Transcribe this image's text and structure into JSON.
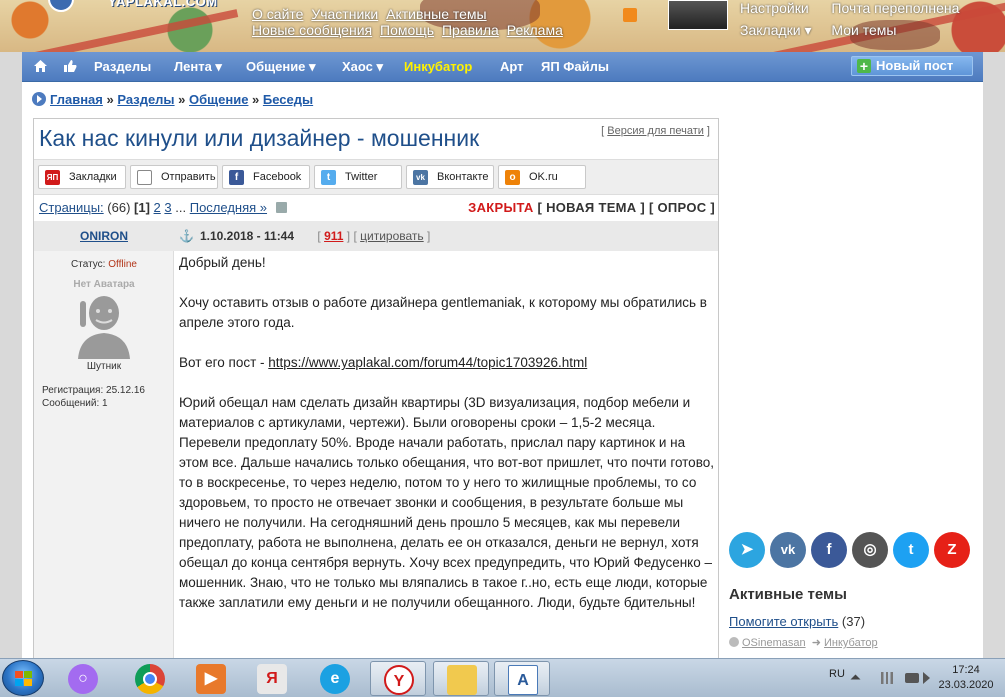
{
  "header": {
    "logo": "YAPLAKAL.COM",
    "links_row1": [
      "О сайте",
      "Участники",
      "Активные темы"
    ],
    "links_row2": [
      "Новые сообщения",
      "Помощь",
      "Правила",
      "Реклама"
    ],
    "user_menu": {
      "col1": [
        "Настройки",
        "Закладки ▾"
      ],
      "col2": [
        "Почта переполнена",
        "Мои темы"
      ]
    }
  },
  "nav": {
    "items": [
      "Разделы",
      "Лента ▾",
      "Общение ▾",
      "Хаос ▾",
      "Инкубатор",
      "Арт",
      "ЯП Файлы"
    ],
    "new_post": "Новый пост"
  },
  "breadcrumb": [
    "Главная",
    "Разделы",
    "Общение",
    "Беседы"
  ],
  "topic": {
    "title": "Как нас кинули или дизайнер - мошенник",
    "print_version": "Версия для печати"
  },
  "share": [
    {
      "label": "Закладки",
      "icon": "yap-bookmark-icon",
      "color": "#d11a1a"
    },
    {
      "label": "Отправить",
      "icon": "mail-icon",
      "color": "#888888"
    },
    {
      "label": "Facebook",
      "icon": "facebook-icon",
      "color": "#3b5998"
    },
    {
      "label": "Twitter",
      "icon": "twitter-icon",
      "color": "#55acee"
    },
    {
      "label": "Вконтакте",
      "icon": "vk-icon",
      "color": "#4c75a3"
    },
    {
      "label": "OK.ru",
      "icon": "ok-icon",
      "color": "#ee8208"
    }
  ],
  "pages": {
    "label": "Страницы:",
    "count": "(66)",
    "current": "[1]",
    "p2": "2",
    "p3": "3",
    "ellipsis": "...",
    "last": "Последняя »",
    "closed": "ЗАКРЫТА",
    "new_topic": "[ НОВАЯ ТЕМА ]",
    "poll": "[ ОПРОС ]"
  },
  "post": {
    "author": "ONIRON",
    "status_label": "Статус:",
    "status": "Offline",
    "avatar_caption": "Нет Аватара",
    "rank": "Шутник",
    "registration": "Регистрация: 25.12.16",
    "messages": "Сообщений: 1",
    "date": "1.10.2018 - 11:44",
    "rating": "911",
    "quote": "цитировать",
    "paragraphs": [
      "Добрый день!",
      "Хочу оставить отзыв о работе дизайнера gentlemaniak, к которому мы обратились в апреле этого года.",
      "Юрий обещал нам сделать дизайн квартиры (3D визуализация, подбор мебели и материалов с артикулами, чертежи). Были оговорены сроки – 1,5-2 месяца. Перевели предоплату 50%. Вроде начали работать, прислал пару картинок и на этом все. Дальше начались только обещания, что вот-вот пришлет, что почти готово, то в воскресенье, то через неделю, потом то у него то жилищные проблемы, то со здоровьем, то просто не отвечает звонки и сообщения, в результате больше мы ничего не получили. На сегодняшний день прошло 5 месяцев, как мы перевели предоплату, работа не выполнена, делать ее он отказался, деньги не вернул, хотя обещал до конца сентября вернуть. Хочу всех предупредить, что Юрий Федусенко – мошенник. Знаю, что не только мы вляпались в такое г..но, есть еще люди, которые также заплатили ему деньги и не получили обещанного. Люди, будьте бдительны!"
    ],
    "link_prefix": "Вот его пост - ",
    "link": "https://www.yaplakal.com/forum44/topic1703926.html"
  },
  "sidebar": {
    "social": [
      {
        "icon": "telegram-icon",
        "glyph": "➤",
        "color": "#2ca5e0"
      },
      {
        "icon": "vk-icon",
        "glyph": "vk",
        "color": "#4c75a3"
      },
      {
        "icon": "facebook-icon",
        "glyph": "f",
        "color": "#3b5998"
      },
      {
        "icon": "instagram-icon",
        "glyph": "◎",
        "color": "#555555"
      },
      {
        "icon": "twitter-icon",
        "glyph": "t",
        "color": "#1da1f2"
      },
      {
        "icon": "zen-icon",
        "glyph": "Z",
        "color": "#e62117"
      }
    ],
    "active_title": "Активные темы",
    "active_topic": "Помогите открыть",
    "active_count": "(37)",
    "active_author": "OSinemasan",
    "active_section": "Инкубатор"
  },
  "taskbar": {
    "lang": "RU",
    "time": "17:24",
    "date": "23.03.2020"
  }
}
